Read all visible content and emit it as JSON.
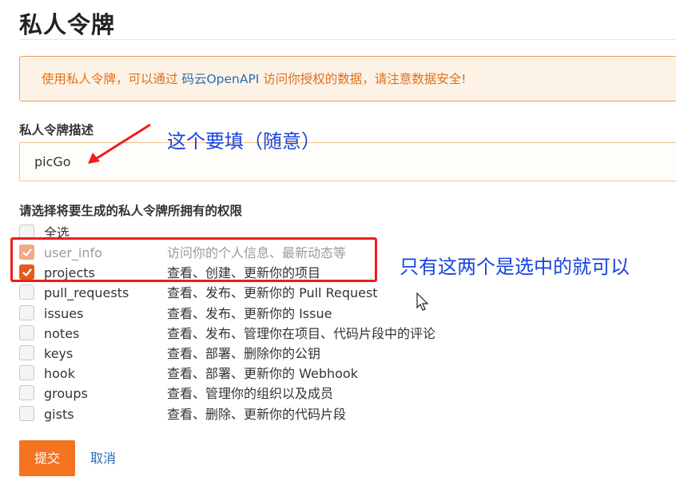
{
  "page": {
    "title": "私人令牌"
  },
  "notice": {
    "prefix": "使用私人令牌，可以通过 ",
    "link": "码云OpenAPI",
    "suffix": " 访问你授权的数据，请注意数据安全!"
  },
  "description": {
    "label": "私人令牌描述",
    "value": "picGo"
  },
  "permissions": {
    "label": "请选择将要生成的私人令牌所拥有的权限",
    "select_all": "全选",
    "items": [
      {
        "name": "user_info",
        "desc": "访问你的个人信息、最新动态等",
        "checked": true,
        "disabled": true
      },
      {
        "name": "projects",
        "desc": "查看、创建、更新你的项目",
        "checked": true,
        "disabled": false
      },
      {
        "name": "pull_requests",
        "desc": "查看、发布、更新你的 Pull Request",
        "checked": false,
        "disabled": false
      },
      {
        "name": "issues",
        "desc": "查看、发布、更新你的 Issue",
        "checked": false,
        "disabled": false
      },
      {
        "name": "notes",
        "desc": "查看、发布、管理你在项目、代码片段中的评论",
        "checked": false,
        "disabled": false
      },
      {
        "name": "keys",
        "desc": "查看、部署、删除你的公钥",
        "checked": false,
        "disabled": false
      },
      {
        "name": "hook",
        "desc": "查看、部署、更新你的 Webhook",
        "checked": false,
        "disabled": false
      },
      {
        "name": "groups",
        "desc": "查看、管理你的组织以及成员",
        "checked": false,
        "disabled": false
      },
      {
        "name": "gists",
        "desc": "查看、删除、更新你的代码片段",
        "checked": false,
        "disabled": false
      }
    ]
  },
  "actions": {
    "submit": "提交",
    "cancel": "取消"
  },
  "annotations": {
    "fill_note": "这个要填（随意）",
    "select_note": "只有这两个是选中的就可以"
  },
  "colors": {
    "accent": "#f5741f",
    "annotation": "#1844e0",
    "highlight": "#ee1c1c"
  }
}
